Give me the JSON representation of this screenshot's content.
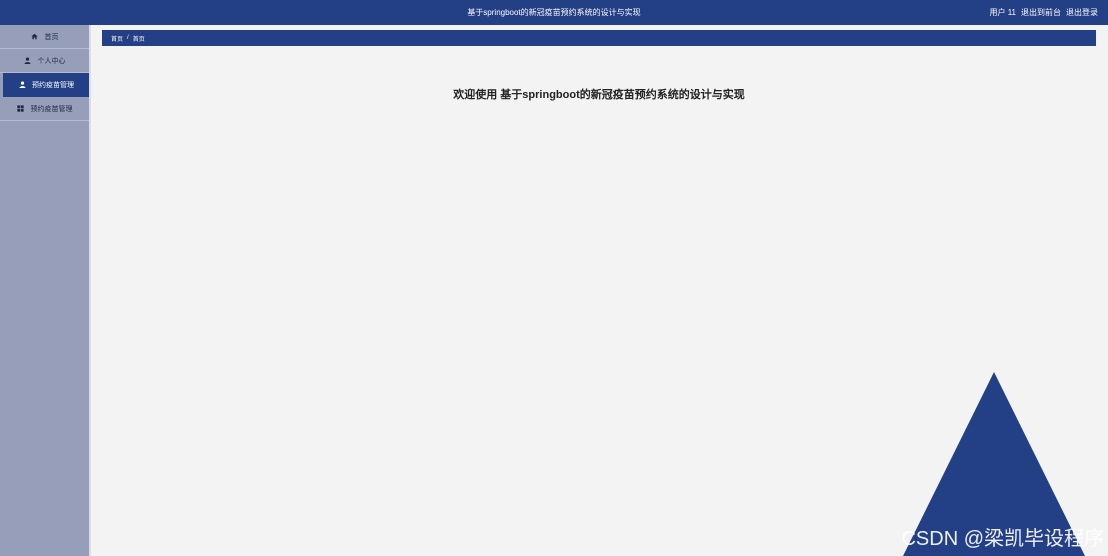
{
  "header": {
    "title": "基于springboot的新冠疫苗预约系统的设计与实现",
    "user": "用户 11",
    "back_to_front": "退出到前台",
    "logout": "退出登录"
  },
  "sidebar": {
    "items": [
      {
        "label": "首页",
        "icon": "home-icon"
      },
      {
        "label": "个人中心",
        "icon": "user-icon"
      },
      {
        "label": "预约疫苗管理",
        "icon": "user-icon"
      },
      {
        "label": "预约疫苗管理",
        "icon": "grid-icon"
      }
    ],
    "active_index": 2
  },
  "breadcrumb": {
    "home": "首页",
    "separator": "/",
    "current": "首页"
  },
  "main": {
    "welcome": "欢迎使用 基于springboot的新冠疫苗预约系统的设计与实现"
  },
  "watermark": "CSDN @梁凯毕设程序",
  "colors": {
    "primary": "#233f85",
    "sidebar_bg": "#969eba",
    "content_bg": "#f3f3f3"
  }
}
